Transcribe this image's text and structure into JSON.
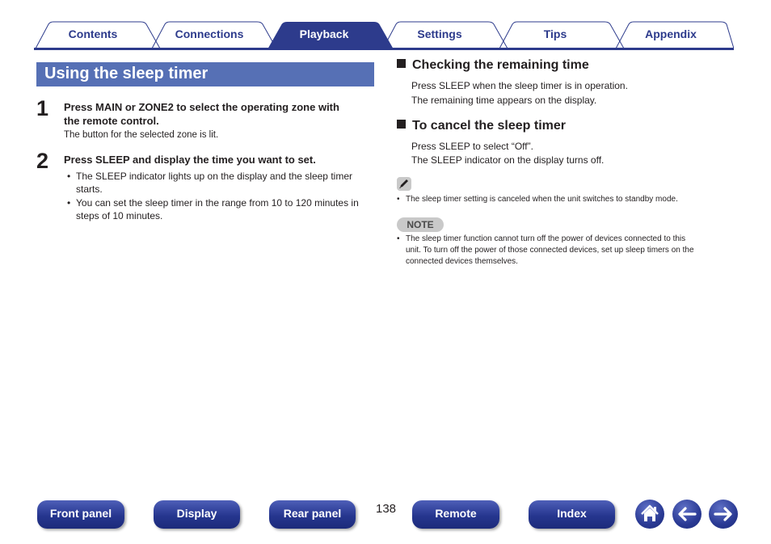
{
  "tabs": [
    {
      "label": "Contents",
      "active": false
    },
    {
      "label": "Connections",
      "active": false
    },
    {
      "label": "Playback",
      "active": true
    },
    {
      "label": "Settings",
      "active": false
    },
    {
      "label": "Tips",
      "active": false
    },
    {
      "label": "Appendix",
      "active": false
    }
  ],
  "colors": {
    "tab_active": "#2d3b8c",
    "tab_text": "#2d3b8c",
    "section_title_bg": "#5670b5",
    "nav_button": "#26368f"
  },
  "section": {
    "title": "Using the sleep timer",
    "steps": [
      {
        "number": "1",
        "heading_line1": "Press MAIN or ZONE2 to select the operating zone with",
        "heading_line2": "the remote control.",
        "text": "The button for the selected zone is lit."
      },
      {
        "number": "2",
        "heading": "Press SLEEP and display the time you want to set.",
        "bullets": [
          {
            "line1": "The SLEEP indicator lights up on the display and the sleep timer",
            "line2": "starts."
          },
          {
            "line1": "You can set the sleep timer in the range from 10 to 120 minutes in",
            "line2": "steps of 10 minutes."
          }
        ]
      }
    ]
  },
  "checking": {
    "heading": "Checking the remaining time",
    "line1": "Press SLEEP when the sleep timer is in operation.",
    "line2": "The remaining time appears on the display."
  },
  "cancel": {
    "heading": "To cancel the sleep timer",
    "line1": "Press SLEEP to select “Off”.",
    "line2": "The SLEEP indicator on the display turns off."
  },
  "memo": {
    "icon": "pencil-icon",
    "bullet": "The sleep timer setting is canceled when the unit switches to standby mode."
  },
  "note": {
    "label": "NOTE",
    "line1": "The sleep timer function cannot turn off the power of devices connected to this",
    "line2": "unit. To turn off the power of those connected devices, set up sleep timers on the",
    "line3": "connected devices themselves."
  },
  "footer": {
    "buttons": [
      "Front panel",
      "Display",
      "Rear panel",
      "Remote",
      "Index"
    ],
    "page_number": "138",
    "icons": [
      "home-icon",
      "arrow-left-icon",
      "arrow-right-icon"
    ]
  }
}
